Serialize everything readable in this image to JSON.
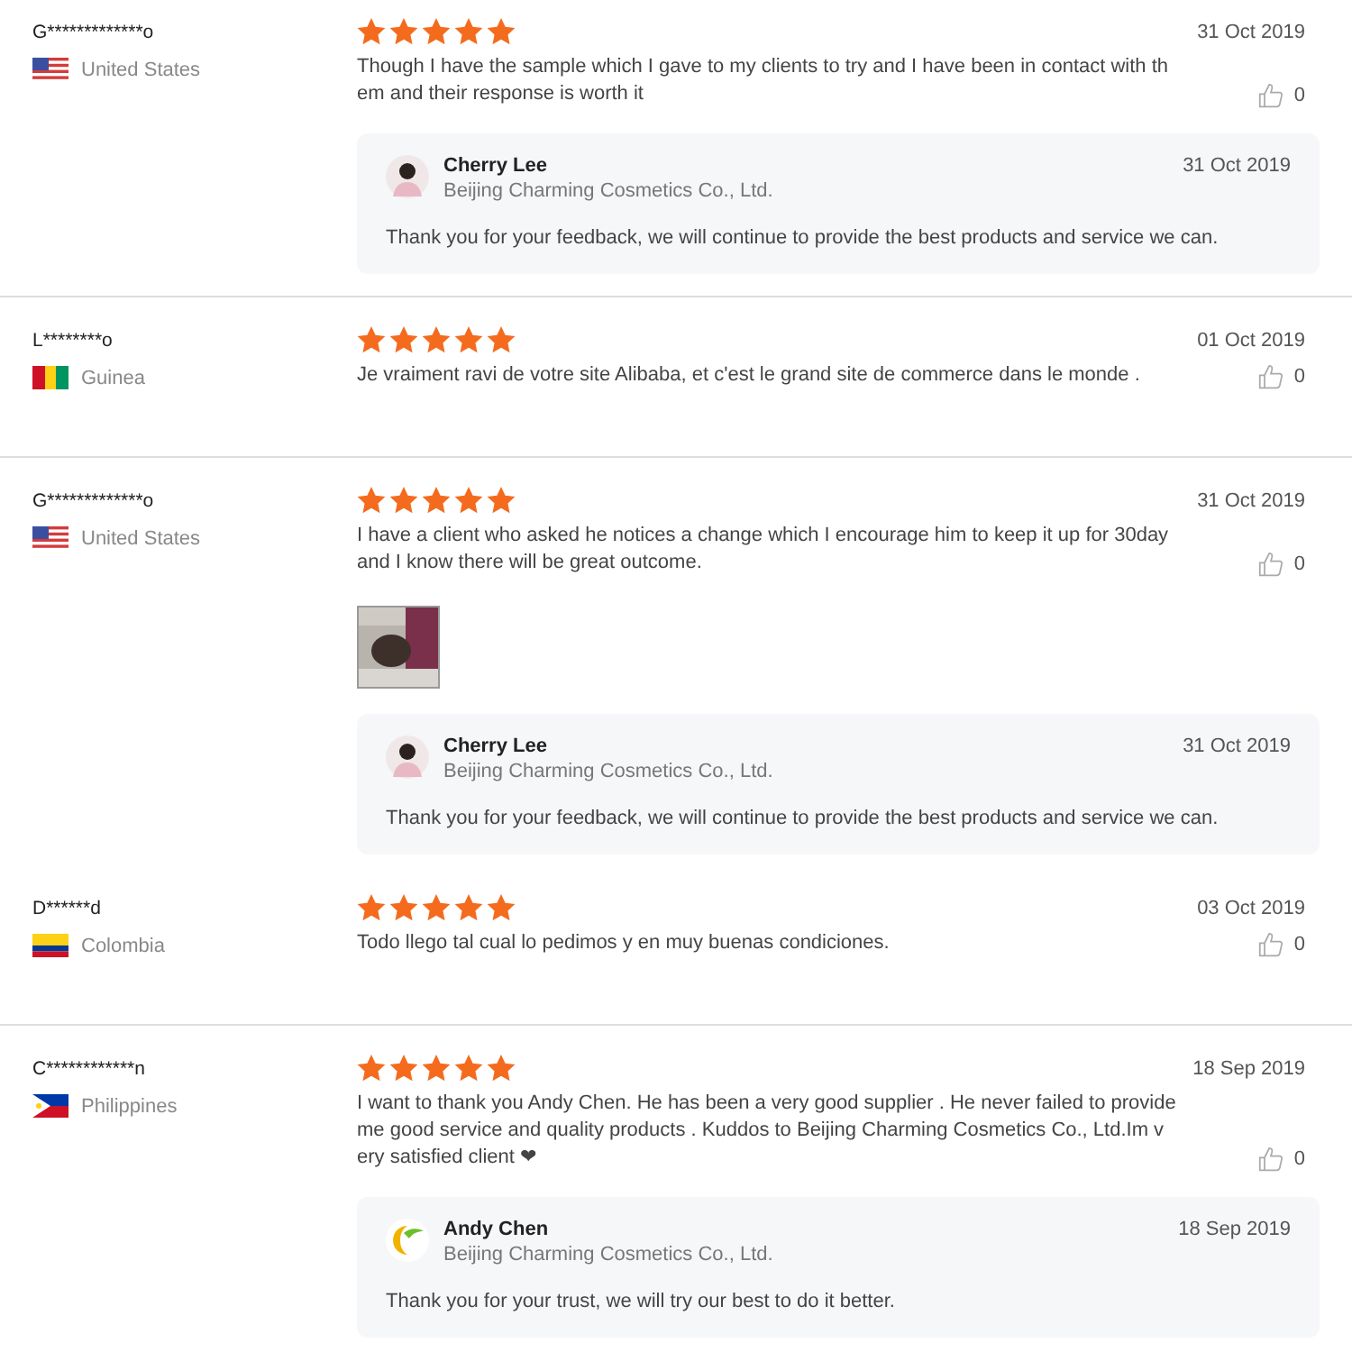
{
  "reviews": [
    {
      "user": "G*************o",
      "flag": {
        "kind": "us"
      },
      "country": "United States",
      "stars": 5,
      "date": "31 Oct 2019",
      "lines": [
        "Though I have the sample which I gave to my clients to try and I have been in contact with th",
        "em and their response is worth it"
      ],
      "likes": "0",
      "divider_below": true,
      "reply": {
        "avatar": {
          "kind": "person"
        },
        "name": "Cherry Lee",
        "company": "Beijing Charming Cosmetics Co., Ltd.",
        "date": "31 Oct 2019",
        "text": "Thank you for your feedback, we will continue to provide the best products and service we can."
      }
    },
    {
      "user": "L********o",
      "flag": {
        "kind": "guinea"
      },
      "country": "Guinea",
      "stars": 5,
      "date": "01 Oct 2019",
      "lines": [
        "Je vraiment ravi de votre site Alibaba, et c'est le grand site de commerce dans le monde ."
      ],
      "likes": "0",
      "divider_below": true
    },
    {
      "user": "G*************o",
      "flag": {
        "kind": "us"
      },
      "country": "United States",
      "stars": 5,
      "date": "31 Oct 2019",
      "lines": [
        "I have a client who asked he notices a change which I encourage him to keep it up for 30day",
        "and I know there will be great outcome."
      ],
      "likes": "0",
      "photos": [
        {
          "kind": "picture"
        }
      ],
      "divider_below": false,
      "reply": {
        "avatar": {
          "kind": "person"
        },
        "name": "Cherry Lee",
        "company": "Beijing Charming Cosmetics Co., Ltd.",
        "date": "31 Oct 2019",
        "text": "Thank you for your feedback, we will continue to provide the best products and service we can."
      }
    },
    {
      "user": "D******d",
      "flag": {
        "kind": "colombia"
      },
      "country": "Colombia",
      "stars": 5,
      "date": "03 Oct 2019",
      "lines": [
        "Todo llego tal cual lo pedimos y en muy buenas condiciones."
      ],
      "likes": "0",
      "divider_below": true
    },
    {
      "user": "C************n",
      "flag": {
        "kind": "philippines"
      },
      "country": "Philippines",
      "stars": 5,
      "date": "18 Sep 2019",
      "lines": [
        "I want to thank you Andy Chen. He has been a very good supplier . He never failed to provide",
        "me good service and quality products . Kuddos to Beijing Charming Cosmetics Co., Ltd.Im v",
        "ery satisfied client ❤"
      ],
      "likes": "0",
      "divider_below": false,
      "reply": {
        "avatar": {
          "kind": "logo"
        },
        "name": "Andy Chen",
        "company": "Beijing Charming Cosmetics Co., Ltd.",
        "date": "18 Sep 2019",
        "text": "Thank you for your trust, we will try our best to do it better."
      }
    }
  ]
}
